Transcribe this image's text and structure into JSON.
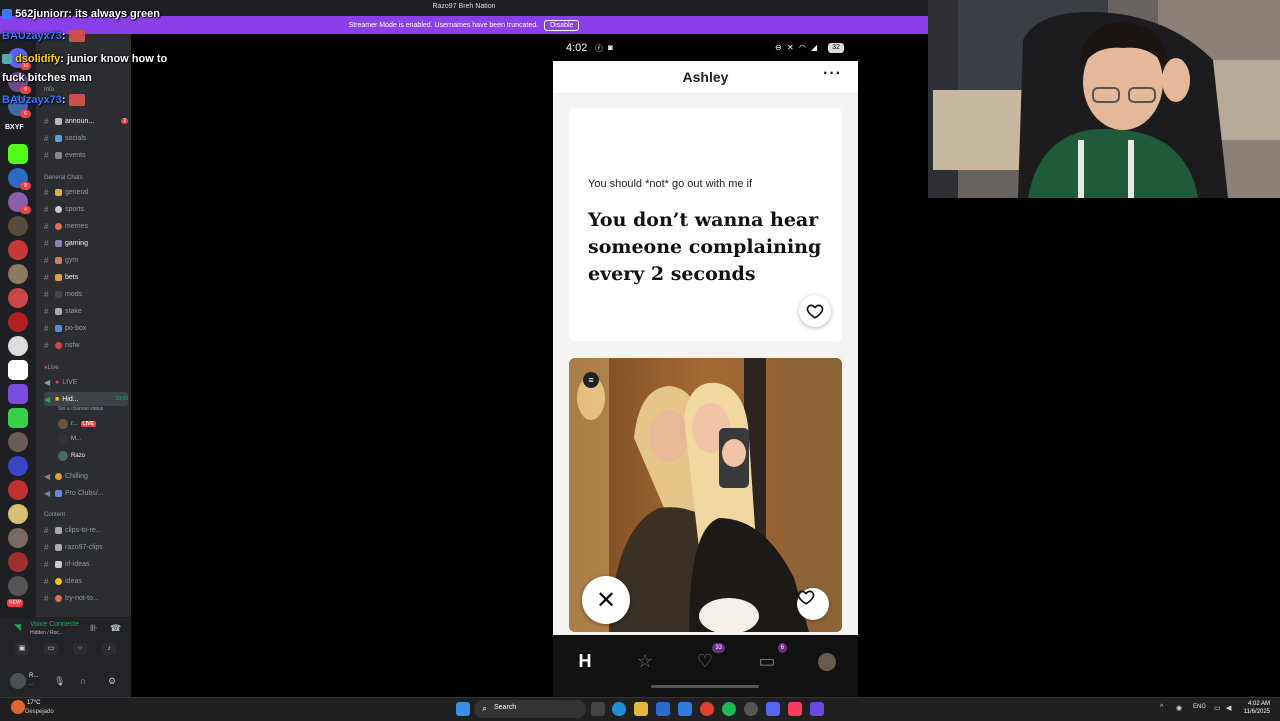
{
  "discord": {
    "title": "Razo97 Breh Nation",
    "streamer_banner": "Streamer Mode is enabled. Usernames have been truncated.",
    "disable_label": "Disable",
    "server_label": "BXYF",
    "guild_badges": [
      "10",
      "9",
      "6",
      "8",
      "4",
      "",
      "",
      "",
      "",
      "",
      "",
      "",
      "",
      "",
      "",
      "",
      "",
      "",
      "",
      "",
      "",
      "NEW"
    ],
    "categories": {
      "info": "Info",
      "general": "General Chats",
      "live": "Live",
      "content": "Content"
    },
    "channels": {
      "announcements": "announ...",
      "announcements_count": "2",
      "socials": "socials",
      "events": "events",
      "general": "general",
      "sports": "sports",
      "memes": "memes",
      "gaming": "gaming",
      "gym": "gym",
      "bets": "bets",
      "mods": "mods",
      "stake": "stake",
      "pobox": "po-box",
      "nsfw": "nsfw",
      "live": "LIVE",
      "hidden": "Hid...",
      "hidden_time": "13:02",
      "set_status": "Set a channel status",
      "chilling": "Chilling",
      "proclubs": "Pro Clubs/...",
      "clips_to_re": "clips-to-re...",
      "razo_clips": "razo97-clips",
      "irl_ideas": "irl-ideas",
      "ideas": "ideas",
      "try_not_to": "try-not-to..."
    },
    "voice_users": {
      "u1": "r...",
      "live": "LIVE",
      "u2": "M...",
      "u3": "Razo"
    },
    "voicebar": {
      "status": "Voice Connecte",
      "sub": "Hidden / Roc..."
    },
    "userbar": {
      "name": "R...",
      "status": "..."
    }
  },
  "chat": [
    {
      "user": "562juniorr",
      "text": ": its always green"
    },
    {
      "user": "BAUzayx73",
      "text": ":"
    },
    {
      "user": "dsolidify",
      "text": ": junior know how to"
    },
    {
      "user": "",
      "text": "fuck bitches man"
    },
    {
      "user": "BAUzayx73",
      "text": ":"
    }
  ],
  "phone": {
    "time": "4:02",
    "battery": "32",
    "profile_name": "Ashley",
    "more": "···",
    "prompt_question": "You should *not* go out with me if",
    "prompt_answer": "You don’t wanna hear someone complaining every 2 seconds",
    "tabs": {
      "likes_badge": "33",
      "messages_badge": "6"
    }
  },
  "taskbar": {
    "temp": "17°C",
    "condition": "Despejado",
    "search": "Search",
    "lang": "ENG",
    "time": "4:02 AM",
    "date": "11/6/2025"
  },
  "colors": {
    "streamer_banner": "#8b3fe8",
    "discord_bg": "#2b2d31",
    "guild_bg": "#1e1f22",
    "badge": "#f23f43",
    "voice_green": "#23a55a",
    "hinge_purple": "#6f2d8a"
  },
  "icons": [
    "heart-icon",
    "close-icon",
    "star-icon",
    "chat-icon",
    "search-icon",
    "windows-icon",
    "mic-icon",
    "headphones-icon",
    "gear-icon"
  ]
}
